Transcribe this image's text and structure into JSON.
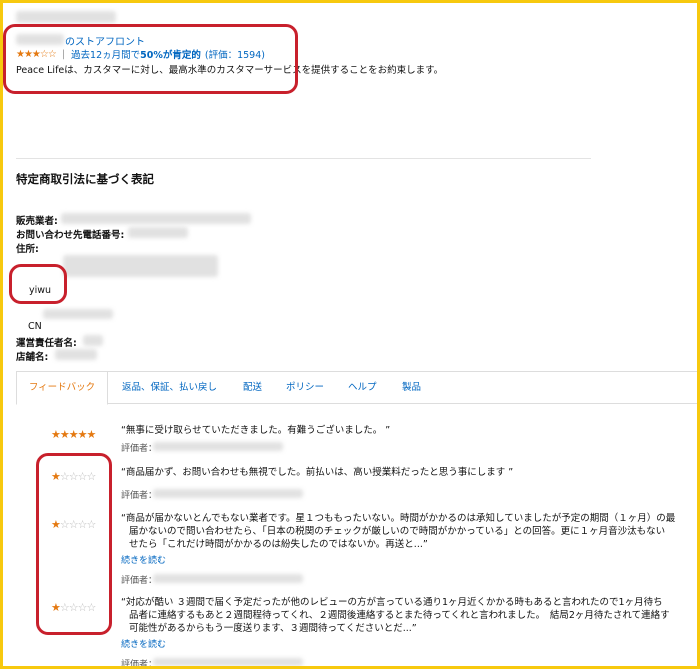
{
  "storefront": {
    "link_suffix": "のストアフロント",
    "stars": "★★★☆☆",
    "rating_prefix": "過去12ヵ月間で",
    "rating_percent": "50%が肯定的",
    "rating_count": "(評価：1594)",
    "description": "Peace Lifeは、カスタマーに対し、最高水準のカスタマーサービスを提供することをお約束します。"
  },
  "legal": {
    "title": "特定商取引法に基づく表記",
    "seller_label": "販売業者:",
    "phone_label": "お問い合わせ先電話番号:",
    "address_label": "住所:",
    "address_city": "yiwu",
    "address_country": "CN",
    "manager_label": "運営責任者名:",
    "shop_label": "店舗名:"
  },
  "tabs": [
    "フィードバック",
    "返品、保証、払い戻し",
    "配送",
    "ポリシー",
    "ヘルプ",
    "製品"
  ],
  "reviews": [
    {
      "rating": 5,
      "stars_on": "★★★★★",
      "stars_off": "",
      "text": "“無事に受け取らせていただきました。有難うございました。 ”",
      "more": "",
      "reviewer_label": "評価者："
    },
    {
      "rating": 1,
      "stars_on": "★",
      "stars_off": "☆☆☆☆",
      "text": "“商品届かず、お問い合わせも無視でした。前払いは、高い授業料だったと思う事にします ”",
      "more": "",
      "reviewer_label": "評価者："
    },
    {
      "rating": 1,
      "stars_on": "★",
      "stars_off": "☆☆☆☆",
      "text": "“とんでもない業者です。星１つももったいない。時間がかかるのは承知していましたが予定の期間（１ヶ月）の最終日になっても届かないので問い合わせたら、「日本の税関のチェックが厳しいので時間がかかっている」との回答。更に１ヶ月音沙汰もない 問い合わせたら「これだけ時間がかかるのは紛失したのではないか。再送と...”",
      "text_display_1": "“商品が届かないとんでもない業者です。星１つももったいない。時間がかかるのは承知していましたが予定の期間（１ヶ月）の最",
      "text_display_2": "届かないので問い合わせたら、「日本の税関のチェックが厳しいので時間がかかっている」との回答。更に１ヶ月音沙汰もない",
      "text_display_3": "せたら「これだけ時間がかかるのは紛失したのではないか。再送と...”",
      "more": "続きを読む",
      "reviewer_label": "評価者："
    },
    {
      "rating": 1,
      "stars_on": "★",
      "stars_off": "☆☆☆☆",
      "text_display_1": "“対応が酷い ３週間で届く予定だったが他のレビューの方が言っている通り1ヶ月近くかかる時もあると言われたので1ヶ月待ち",
      "text_display_2": "品者に連絡するもあと２週間程待ってくれ、２週間後連絡するとまた待ってくれと言われました。　結局2ヶ月待たされて連絡す",
      "text_display_3": "可能性があるからもう一度送ります、３週間待ってくださいとだ...”",
      "more": "続きを読む",
      "reviewer_label": "評価者："
    }
  ],
  "colors": {
    "frame_border": "#f7c90f",
    "highlight_box": "#c8202c",
    "link": "#0066c0",
    "star": "#e47911",
    "active_tab": "#e47911"
  }
}
